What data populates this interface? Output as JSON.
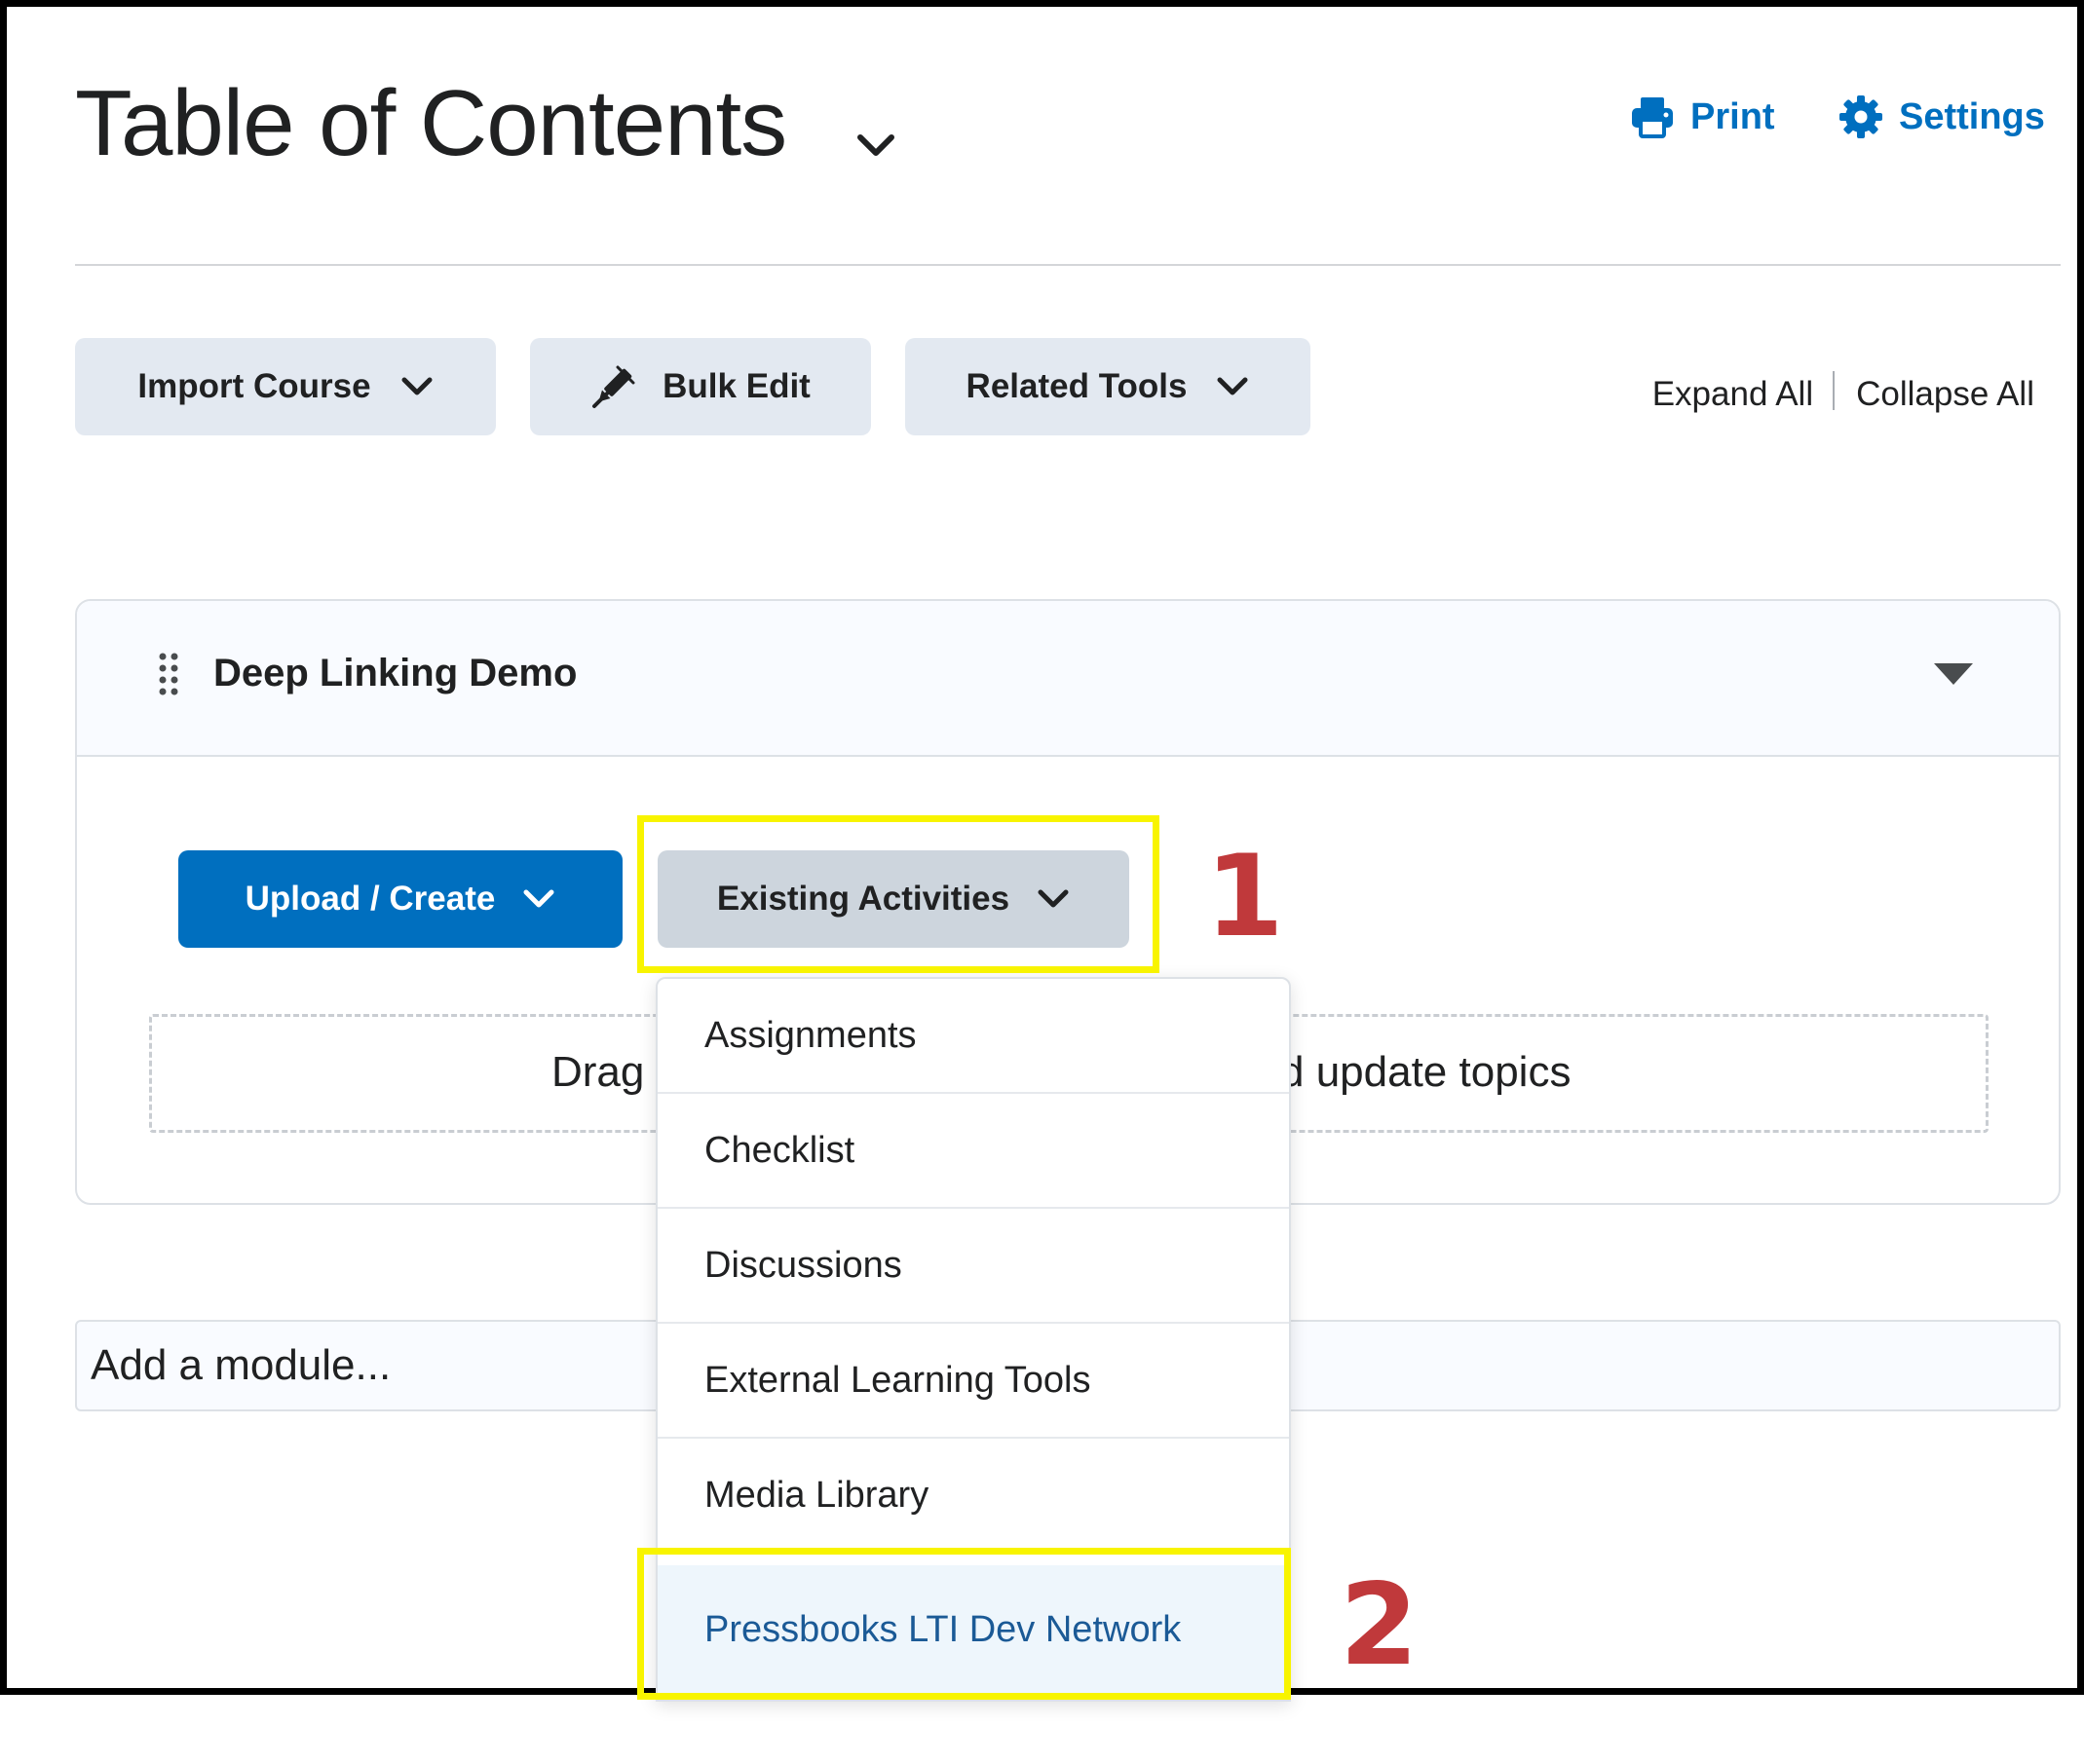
{
  "header": {
    "title": "Table of Contents",
    "print_label": "Print",
    "settings_label": "Settings"
  },
  "toolbar": {
    "import_label": "Import Course",
    "bulk_edit_label": "Bulk Edit",
    "related_tools_label": "Related Tools",
    "expand_all_label": "Expand All",
    "collapse_all_label": "Collapse All"
  },
  "module": {
    "title": "Deep Linking Demo",
    "upload_label": "Upload / Create",
    "existing_label": "Existing Activities",
    "drop_text_left": "Drag",
    "drop_text_right": "d update topics"
  },
  "add_module": {
    "placeholder": "Add a module..."
  },
  "dropdown": {
    "items": [
      {
        "label": "Assignments"
      },
      {
        "label": "Checklist"
      },
      {
        "label": "Discussions"
      },
      {
        "label": "External Learning Tools"
      },
      {
        "label": "Media Library"
      },
      {
        "label": "Pressbooks LTI Dev Network"
      }
    ],
    "highlighted_item": "Pressbooks LTI Dev Network"
  },
  "annotations": {
    "step_1": "1",
    "step_2": "2",
    "highlight_color": "#f8f400",
    "number_color": "#c0393b"
  },
  "colors": {
    "accent": "#006fbf",
    "button_bg": "#e3e9f1",
    "active_button_bg": "#cdd5dd"
  }
}
